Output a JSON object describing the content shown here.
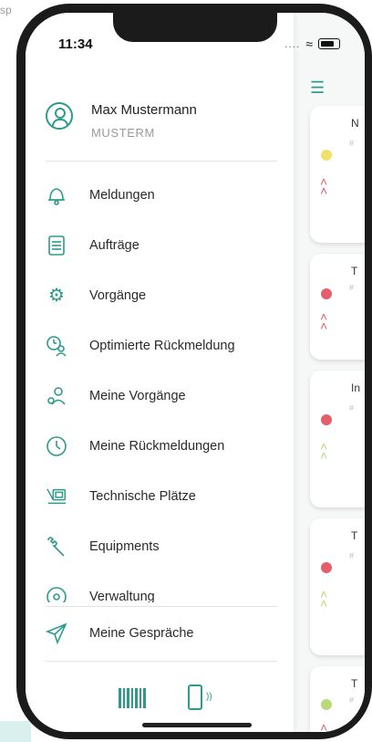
{
  "page_caption": "sp",
  "status": {
    "time": "11:34",
    "dots": "....",
    "wifi_icon": "wifi-icon",
    "battery_icon": "battery-icon"
  },
  "user": {
    "name": "Max Mustermann",
    "code": "MUSTERM"
  },
  "menu": [
    {
      "label": "Meldungen",
      "icon": "bell-icon"
    },
    {
      "label": "Aufträge",
      "icon": "document-icon"
    },
    {
      "label": "Vorgänge",
      "icon": "gear-icon"
    },
    {
      "label": "Optimierte Rückmeldung",
      "icon": "clock-user-icon"
    },
    {
      "label": "Meine Vorgänge",
      "icon": "user-gear-icon"
    },
    {
      "label": "Meine Rückmeldungen",
      "icon": "clock-icon"
    },
    {
      "label": "Technische Plätze",
      "icon": "machine-icon"
    },
    {
      "label": "Equipments",
      "icon": "wrench-icon"
    },
    {
      "label": "Verwaltung",
      "icon": "admin-icon"
    }
  ],
  "bottom_item": {
    "label": "Meine Gespräche",
    "icon": "send-icon"
  },
  "toolbar": {
    "barcode_icon": "barcode-icon",
    "device_icon": "phone-nfc-icon"
  },
  "cards": [
    {
      "title": "N",
      "dot_color": "#f3df6b",
      "priority_color": "#e45f6b",
      "small": "#"
    },
    {
      "title": "T",
      "dot_color": "#e45f6b",
      "priority_color": "#e45f6b",
      "small": "#"
    },
    {
      "title": "In",
      "dot_color": "#e45f6b",
      "priority_color": "#b9d97a",
      "small": "#"
    },
    {
      "title": "T",
      "dot_color": "#e45f6b",
      "priority_color": "#b9d97a",
      "small": "#"
    },
    {
      "title": "T",
      "dot_color": "#b9d97a",
      "priority_color": "#e45f6b",
      "small": "#"
    }
  ],
  "colors": {
    "accent": "#2c9b8b",
    "drawer_bg": "#ffffff",
    "main_bg": "#f6f7f7"
  }
}
